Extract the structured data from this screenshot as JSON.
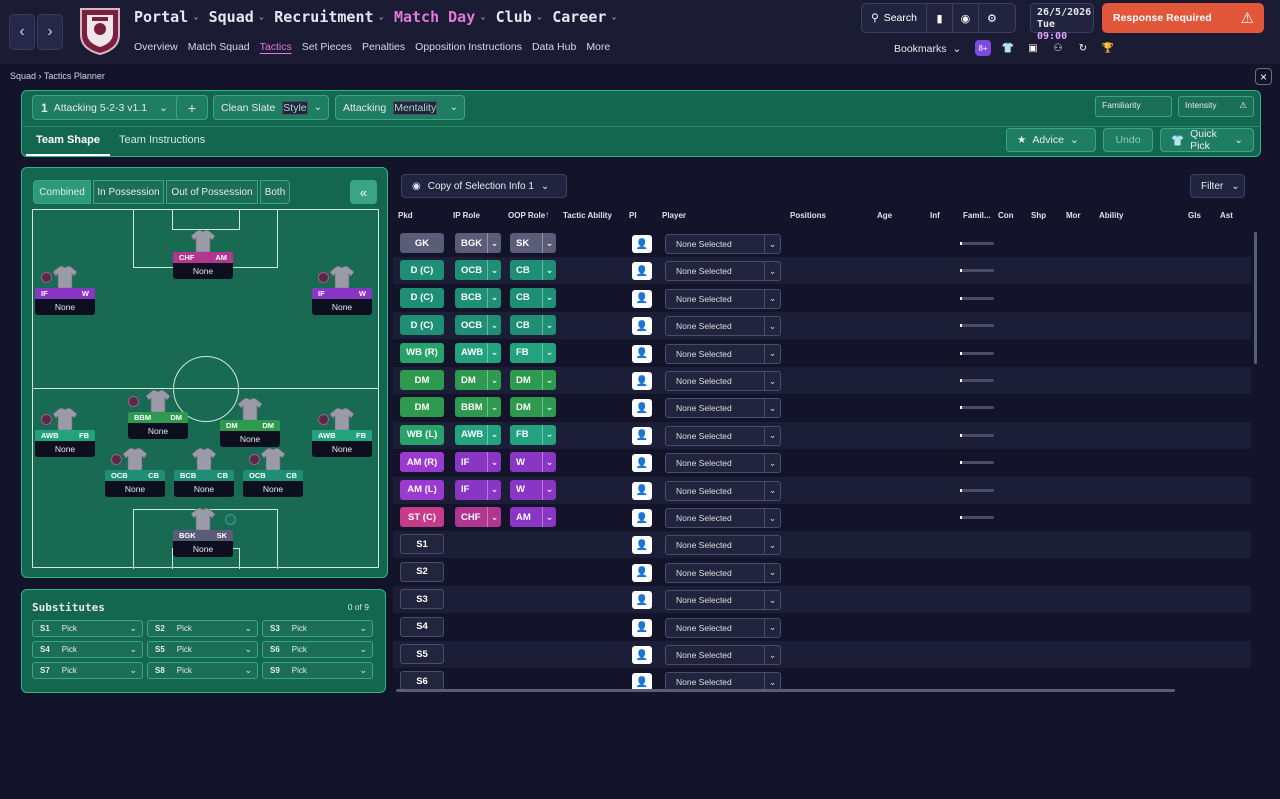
{
  "nav": {
    "main": [
      {
        "label": "Portal",
        "active": false
      },
      {
        "label": "Squad",
        "active": false
      },
      {
        "label": "Recruitment",
        "active": false
      },
      {
        "label": "Match Day",
        "active": true
      },
      {
        "label": "Club",
        "active": false
      },
      {
        "label": "Career",
        "active": false
      }
    ],
    "sub": [
      {
        "label": "Overview"
      },
      {
        "label": "Match Squad"
      },
      {
        "label": "Tactics",
        "active": true
      },
      {
        "label": "Set Pieces"
      },
      {
        "label": "Penalties"
      },
      {
        "label": "Opposition Instructions"
      },
      {
        "label": "Data Hub"
      },
      {
        "label": "More"
      }
    ],
    "search_label": "Search",
    "date": "26/5/2026",
    "day": "Tue",
    "time": "09:00",
    "response_label": "Response Required",
    "bookmarks_label": "Bookmarks"
  },
  "breadcrumb": {
    "a": "Squad",
    "b": "Tactics Planner"
  },
  "tactic": {
    "number": "1",
    "name": "Attacking 5-2-3 v1.1",
    "style_value": "Clean Slate",
    "style_label": "Style",
    "mentality_value": "Attacking",
    "mentality_label": "Mentality",
    "familiarity_label": "Familiarity",
    "intensity_label": "Intensity",
    "tabs": [
      "Team Shape",
      "Team Instructions"
    ],
    "advice_label": "Advice",
    "undo_label": "Undo",
    "quickpick_label": "Quick Pick"
  },
  "pitch": {
    "segments": [
      "Combined",
      "In Possession",
      "Out of Possession",
      "Both"
    ],
    "players": [
      {
        "r1": "CHF",
        "r2": "AM",
        "name": "None",
        "color": "#b0368f"
      },
      {
        "r1": "IF",
        "r2": "W",
        "name": "None",
        "color": "#8a36c4"
      },
      {
        "r1": "IF",
        "r2": "W",
        "name": "None",
        "color": "#8a36c4"
      },
      {
        "r1": "BBM",
        "r2": "DM",
        "name": "None",
        "color": "#2d9a50"
      },
      {
        "r1": "DM",
        "r2": "DM",
        "name": "None",
        "color": "#2d9a50"
      },
      {
        "r1": "AWB",
        "r2": "FB",
        "name": "None",
        "color": "#23a27e"
      },
      {
        "r1": "AWB",
        "r2": "FB",
        "name": "None",
        "color": "#23a27e"
      },
      {
        "r1": "OCB",
        "r2": "CB",
        "name": "None",
        "color": "#1e8f74"
      },
      {
        "r1": "BCB",
        "r2": "CB",
        "name": "None",
        "color": "#1e8f74"
      },
      {
        "r1": "OCB",
        "r2": "CB",
        "name": "None",
        "color": "#1e8f74"
      },
      {
        "r1": "BGK",
        "r2": "SK",
        "name": "None",
        "color": "#5b5d78"
      }
    ]
  },
  "subs": {
    "title": "Substitutes",
    "count": "0 of 9",
    "slots": [
      {
        "s": "S1",
        "v": "Pick"
      },
      {
        "s": "S2",
        "v": "Pick"
      },
      {
        "s": "S3",
        "v": "Pick"
      },
      {
        "s": "S4",
        "v": "Pick"
      },
      {
        "s": "S5",
        "v": "Pick"
      },
      {
        "s": "S6",
        "v": "Pick"
      },
      {
        "s": "S7",
        "v": "Pick"
      },
      {
        "s": "S8",
        "v": "Pick"
      },
      {
        "s": "S9",
        "v": "Pick"
      }
    ]
  },
  "table": {
    "copy_label": "Copy of Selection Info 1",
    "filter_label": "Filter",
    "headers": [
      "Pkd",
      "IP Role",
      "OOP Role",
      "Tactic Ability",
      "PI",
      "Player",
      "Positions",
      "Age",
      "Inf",
      "Famil...",
      "Con",
      "Shp",
      "Mor",
      "Ability",
      "Gls",
      "Ast"
    ],
    "rows": [
      {
        "pos": "GK",
        "cls": "gk",
        "ip": "BGK",
        "oop": "SK",
        "player": "None Selected"
      },
      {
        "pos": "D (C)",
        "cls": "def",
        "ip": "OCB",
        "oop": "CB",
        "player": "None Selected"
      },
      {
        "pos": "D (C)",
        "cls": "def",
        "ip": "BCB",
        "oop": "CB",
        "player": "None Selected"
      },
      {
        "pos": "D (C)",
        "cls": "def",
        "ip": "OCB",
        "oop": "CB",
        "player": "None Selected"
      },
      {
        "pos": "WB (R)",
        "cls": "wb",
        "ip": "AWB",
        "oop": "FB",
        "player": "None Selected"
      },
      {
        "pos": "DM",
        "cls": "dm",
        "ip": "DM",
        "oop": "DM",
        "player": "None Selected"
      },
      {
        "pos": "DM",
        "cls": "dm",
        "ip": "BBM",
        "oop": "DM",
        "player": "None Selected"
      },
      {
        "pos": "WB (L)",
        "cls": "wb",
        "ip": "AWB",
        "oop": "FB",
        "player": "None Selected"
      },
      {
        "pos": "AM (R)",
        "cls": "am",
        "ip": "IF",
        "oop": "W",
        "player": "None Selected"
      },
      {
        "pos": "AM (L)",
        "cls": "am",
        "ip": "IF",
        "oop": "W",
        "player": "None Selected"
      },
      {
        "pos": "ST (C)",
        "cls": "st",
        "ip": "CHF",
        "oop": "AM",
        "player": "None Selected"
      },
      {
        "pos": "S1",
        "cls": "sub",
        "ip": "",
        "oop": "",
        "player": "None Selected"
      },
      {
        "pos": "S2",
        "cls": "sub",
        "ip": "",
        "oop": "",
        "player": "None Selected"
      },
      {
        "pos": "S3",
        "cls": "sub",
        "ip": "",
        "oop": "",
        "player": "None Selected"
      },
      {
        "pos": "S4",
        "cls": "sub",
        "ip": "",
        "oop": "",
        "player": "None Selected"
      },
      {
        "pos": "S5",
        "cls": "sub",
        "ip": "",
        "oop": "",
        "player": "None Selected"
      },
      {
        "pos": "S6",
        "cls": "sub",
        "ip": "",
        "oop": "",
        "player": "None Selected"
      }
    ]
  }
}
